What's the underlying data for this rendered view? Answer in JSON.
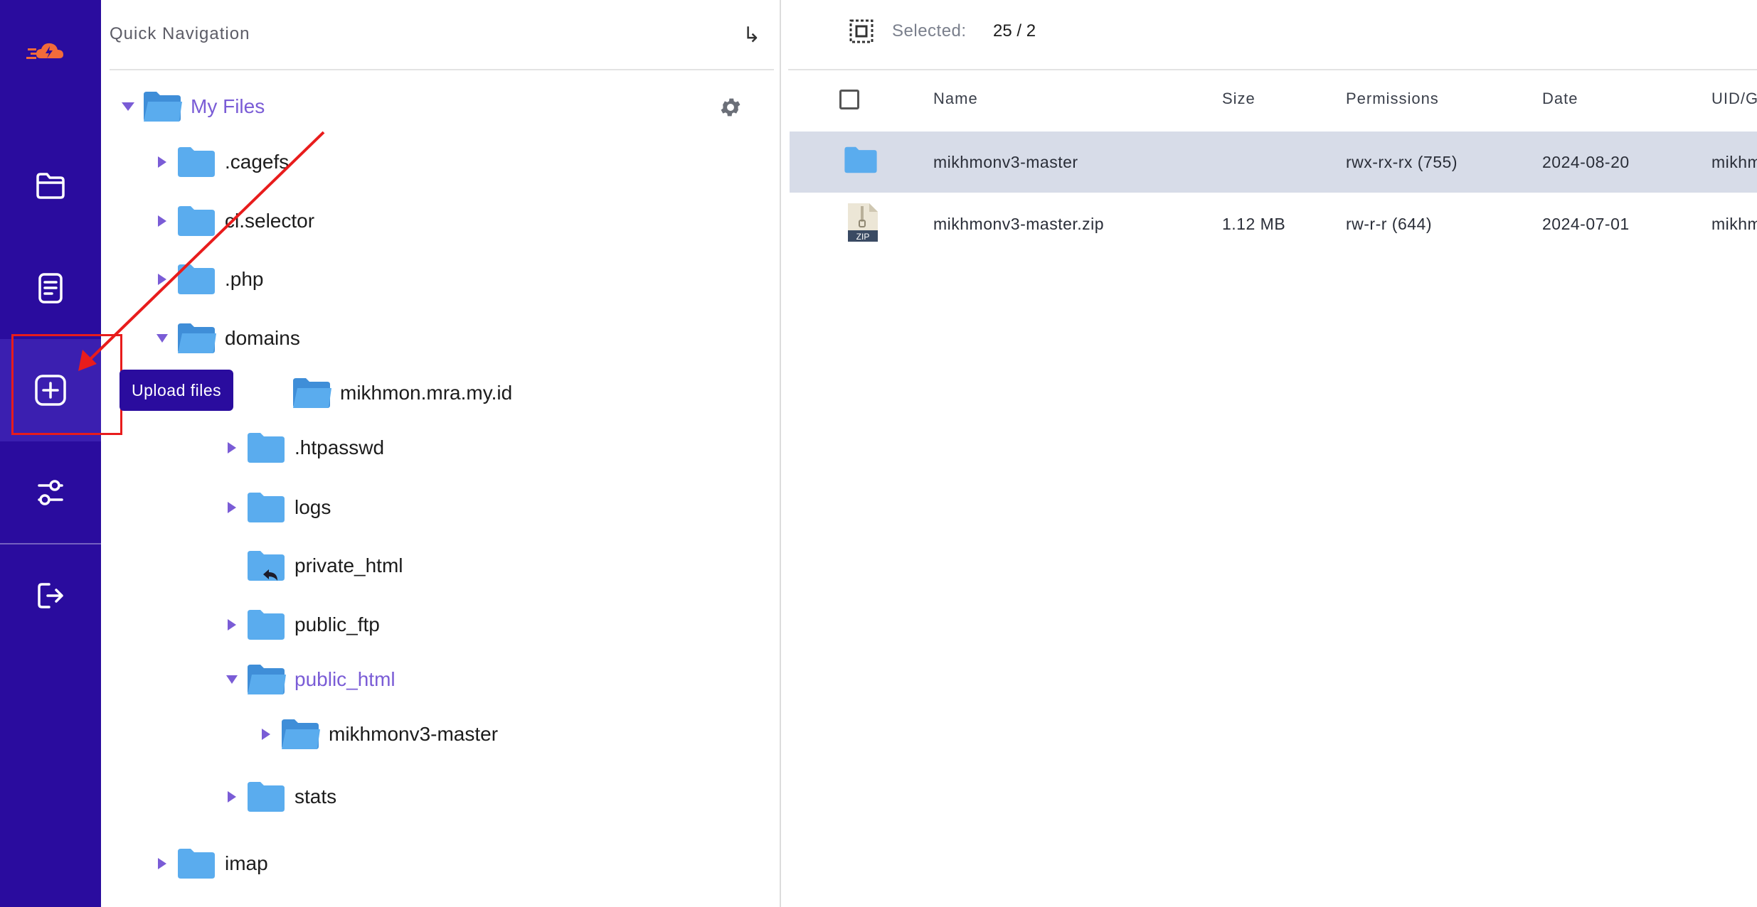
{
  "tooltip": {
    "text": "Upload files"
  },
  "sidebar": {
    "items": [
      {
        "icon": "brand-logo-icon"
      },
      {
        "icon": "folder-icon"
      },
      {
        "icon": "document-icon"
      },
      {
        "icon": "plus-square-icon",
        "tooltip": "Upload files"
      },
      {
        "icon": "sliders-icon"
      },
      {
        "icon": "logout-icon"
      }
    ],
    "accent_color": "#2a0c9e"
  },
  "tree": {
    "title": "Quick Navigation",
    "go_symbol": "↳",
    "root": "My Files",
    "nodes": [
      {
        "label": ".cagefs"
      },
      {
        "label": "cl.selector"
      },
      {
        "label": ".php"
      },
      {
        "label": "domains"
      },
      {
        "label": "mikhmon.mra.my.id"
      },
      {
        "label": ".htpasswd"
      },
      {
        "label": "logs"
      },
      {
        "label": "private_html"
      },
      {
        "label": "public_ftp"
      },
      {
        "label": "public_html"
      },
      {
        "label": "mikhmonv3-master"
      },
      {
        "label": "stats"
      },
      {
        "label": "imap"
      }
    ]
  },
  "main": {
    "selected_label": "Selected:",
    "selected_value": "25 / 2",
    "columns": [
      "Name",
      "Size",
      "Permissions",
      "Date",
      "UID/G"
    ],
    "rows": [
      {
        "name": "mikhmonv3-master",
        "size": "",
        "permissions": "rwx-rx-rx (755)",
        "date": "2024-08-20",
        "uid": "mikhm",
        "icon": "folder-icon"
      },
      {
        "name": "mikhmonv3-master.zip",
        "size": "1.12 MB",
        "permissions": "rw-r-r (644)",
        "date": "2024-07-01",
        "uid": "mikhm",
        "icon": "zip-file-icon",
        "icon_text": "ZIP"
      }
    ]
  },
  "annotation": {
    "color": "#e81c1c"
  }
}
